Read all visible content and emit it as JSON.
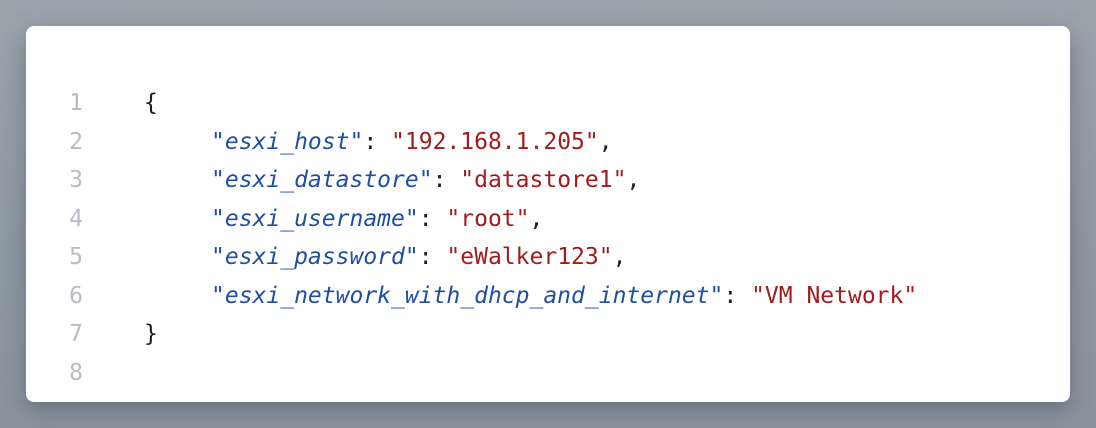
{
  "code_lines": [
    {
      "number": "1",
      "open": "{"
    },
    {
      "number": "2",
      "key": "\"esxi_host\"",
      "colon": ": ",
      "value": "\"192.168.1.205\"",
      "comma": ","
    },
    {
      "number": "3",
      "key": "\"esxi_datastore\"",
      "colon": ": ",
      "value": "\"datastore1\"",
      "comma": ","
    },
    {
      "number": "4",
      "key": "\"esxi_username\"",
      "colon": ": ",
      "value": "\"root\"",
      "comma": ","
    },
    {
      "number": "5",
      "key": "\"esxi_password\"",
      "colon": ": ",
      "value": "\"eWalker123\"",
      "comma": ","
    },
    {
      "number": "6",
      "key": "\"esxi_network_with_dhcp_and_internet\"",
      "colon": ": ",
      "value": "\"VM Network\"",
      "comma": ""
    },
    {
      "number": "7",
      "close": "}"
    },
    {
      "number": "8"
    }
  ],
  "colors": {
    "key": "#1f4fa0",
    "string": "#a11d1d",
    "line_number": "#b8bcc2",
    "background": "#ffffff"
  }
}
